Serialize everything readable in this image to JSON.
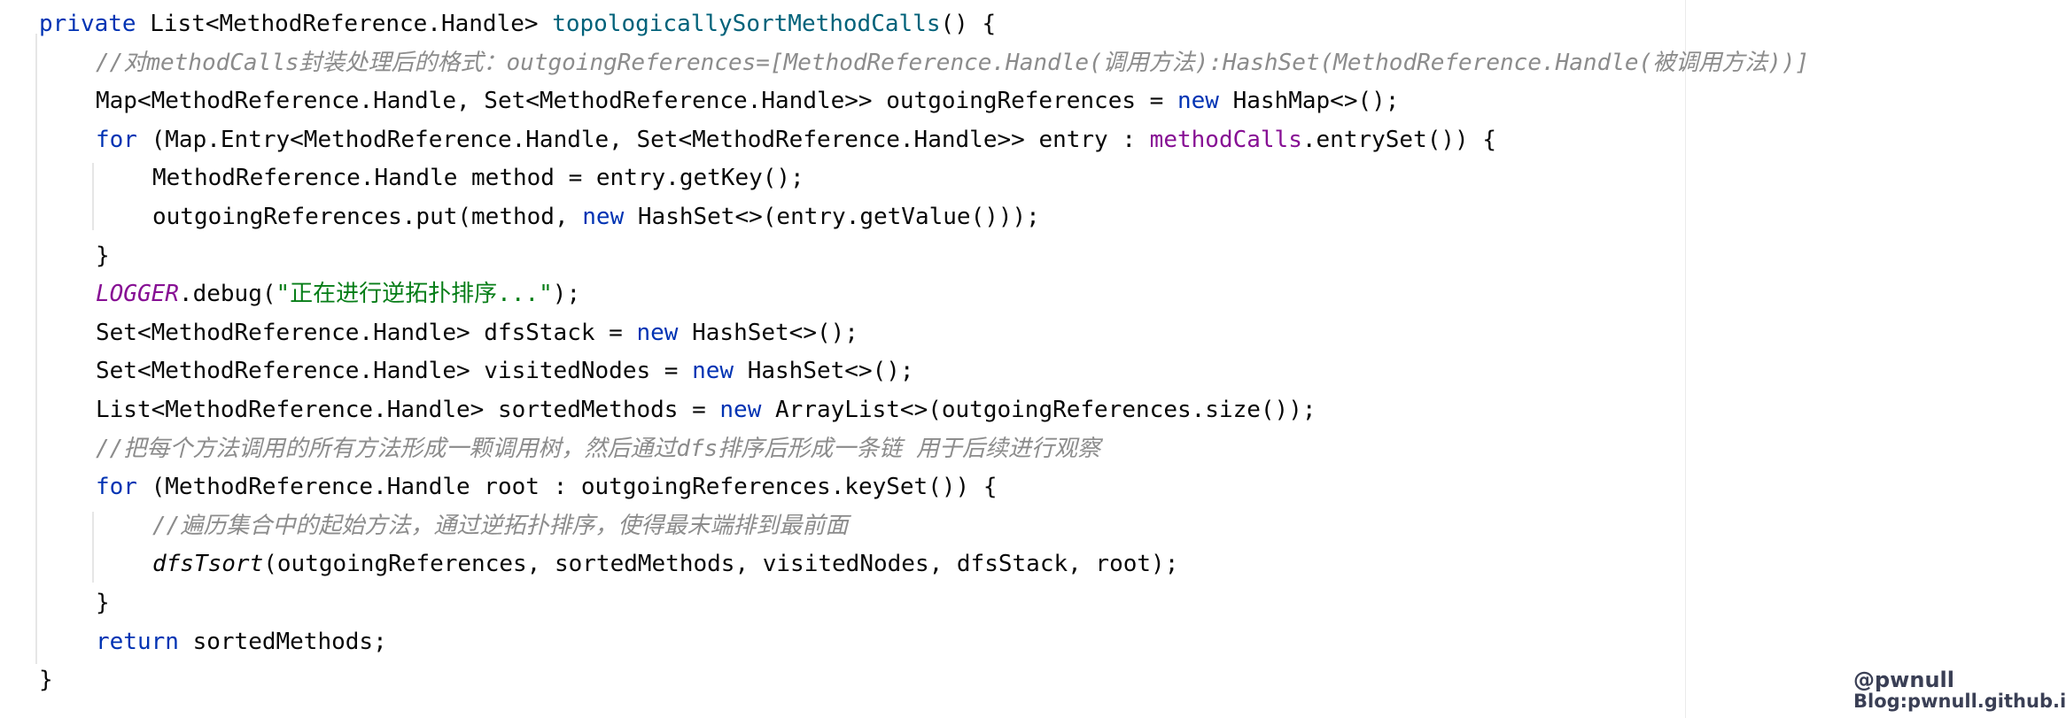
{
  "code": {
    "lines": [
      {
        "indent": 0,
        "tokens": [
          {
            "t": "private ",
            "c": "kw"
          },
          {
            "t": "List<MethodReference.Handle> ",
            "c": "type"
          },
          {
            "t": "topologicallySortMethodCalls",
            "c": "mdecl"
          },
          {
            "t": "() {",
            "c": "type"
          }
        ]
      },
      {
        "indent": 1,
        "tokens": [
          {
            "t": "//",
            "c": "comment"
          },
          {
            "t": "对",
            "c": "comment cjk"
          },
          {
            "t": "methodCalls",
            "c": "comment"
          },
          {
            "t": "封装处理后的格式：",
            "c": "comment cjk"
          },
          {
            "t": "outgoingReferences=[MethodReference.Handle(",
            "c": "comment"
          },
          {
            "t": "调用方法",
            "c": "comment cjk"
          },
          {
            "t": "):HashSet(MethodReference.Handle(",
            "c": "comment"
          },
          {
            "t": "被调用方法",
            "c": "comment cjk"
          },
          {
            "t": "))]",
            "c": "comment"
          }
        ]
      },
      {
        "indent": 1,
        "tokens": [
          {
            "t": "Map<MethodReference.Handle, Set<MethodReference.Handle>> outgoingReferences = ",
            "c": "type"
          },
          {
            "t": "new ",
            "c": "kw"
          },
          {
            "t": "HashMap<>();",
            "c": "type"
          }
        ]
      },
      {
        "indent": 1,
        "tokens": [
          {
            "t": "for ",
            "c": "kw"
          },
          {
            "t": "(Map.Entry<MethodReference.Handle, Set<MethodReference.Handle>> entry : ",
            "c": "type"
          },
          {
            "t": "methodCalls",
            "c": "field"
          },
          {
            "t": ".entrySet()) {",
            "c": "type"
          }
        ]
      },
      {
        "indent": 2,
        "tokens": [
          {
            "t": "MethodReference.Handle method = entry.getKey();",
            "c": "type"
          }
        ]
      },
      {
        "indent": 2,
        "tokens": [
          {
            "t": "outgoingReferences.put(method, ",
            "c": "type"
          },
          {
            "t": "new ",
            "c": "kw"
          },
          {
            "t": "HashSet<>(entry.getValue()));",
            "c": "type"
          }
        ]
      },
      {
        "indent": 1,
        "tokens": [
          {
            "t": "}",
            "c": "type"
          }
        ]
      },
      {
        "indent": 1,
        "tokens": [
          {
            "t": "LOGGER",
            "c": "static-field"
          },
          {
            "t": ".debug(",
            "c": "type"
          },
          {
            "t": "\"",
            "c": "str"
          },
          {
            "t": "正在进行逆拓扑排序",
            "c": "str cjk"
          },
          {
            "t": "...\"",
            "c": "str"
          },
          {
            "t": ");",
            "c": "type"
          }
        ]
      },
      {
        "indent": 1,
        "tokens": [
          {
            "t": "Set<MethodReference.Handle> dfsStack = ",
            "c": "type"
          },
          {
            "t": "new ",
            "c": "kw"
          },
          {
            "t": "HashSet<>();",
            "c": "type"
          }
        ]
      },
      {
        "indent": 1,
        "tokens": [
          {
            "t": "Set<MethodReference.Handle> visitedNodes = ",
            "c": "type"
          },
          {
            "t": "new ",
            "c": "kw"
          },
          {
            "t": "HashSet<>();",
            "c": "type"
          }
        ]
      },
      {
        "indent": 1,
        "tokens": [
          {
            "t": "List<MethodReference.Handle> sortedMethods = ",
            "c": "type"
          },
          {
            "t": "new ",
            "c": "kw"
          },
          {
            "t": "ArrayList<>(outgoingReferences.size());",
            "c": "type"
          }
        ]
      },
      {
        "indent": 1,
        "tokens": [
          {
            "t": "//",
            "c": "comment"
          },
          {
            "t": "把每个方法调用的所有方法形成一颗调用树，然后通过",
            "c": "comment cjk"
          },
          {
            "t": "dfs",
            "c": "comment"
          },
          {
            "t": "排序后形成一条链 用于后续进行观察",
            "c": "comment cjk"
          }
        ]
      },
      {
        "indent": 1,
        "tokens": [
          {
            "t": "for ",
            "c": "kw"
          },
          {
            "t": "(MethodReference.Handle root : outgoingReferences.keySet()) {",
            "c": "type"
          }
        ]
      },
      {
        "indent": 2,
        "tokens": [
          {
            "t": "//",
            "c": "comment"
          },
          {
            "t": "遍历集合中的起始方法，通过逆拓扑排序，使得最末端排到最前面",
            "c": "comment cjk"
          }
        ]
      },
      {
        "indent": 2,
        "tokens": [
          {
            "t": "dfsTsort",
            "c": "static-call"
          },
          {
            "t": "(outgoingReferences, sortedMethods, visitedNodes, dfsStack, root);",
            "c": "type"
          }
        ]
      },
      {
        "indent": 1,
        "tokens": [
          {
            "t": "}",
            "c": "type"
          }
        ]
      },
      {
        "indent": 1,
        "tokens": [
          {
            "t": "return ",
            "c": "kw"
          },
          {
            "t": "sortedMethods;",
            "c": "type"
          }
        ]
      },
      {
        "indent": 0,
        "tokens": [
          {
            "t": "}",
            "c": "type"
          }
        ]
      }
    ]
  },
  "watermark": {
    "handle": "@pwnull",
    "blog": "Blog:pwnull.github.io"
  },
  "colors": {
    "keyword": "#0033b3",
    "method_declaration": "#00627a",
    "field": "#871094",
    "string": "#067d17",
    "comment": "#8c8c8c",
    "text": "#080808",
    "background": "#ffffff"
  }
}
